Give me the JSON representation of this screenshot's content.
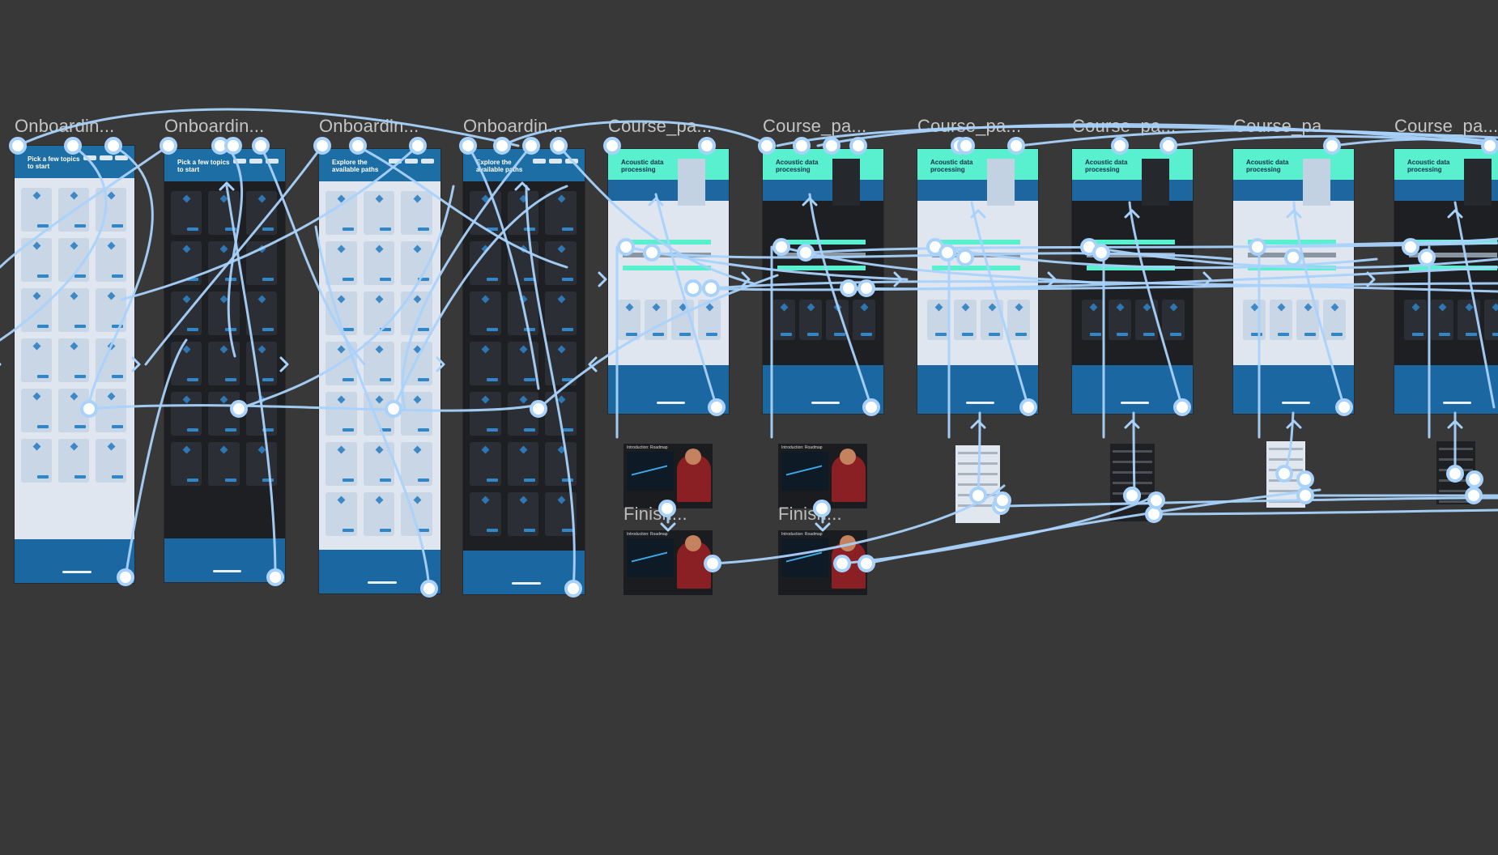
{
  "canvas": {
    "background": "#383838",
    "wire_color": "#a9d2fb",
    "node_fill": "#ffffff"
  },
  "frames": [
    {
      "label": "Onboardin...",
      "theme": "light",
      "kind": "onboarding",
      "title": "Pick a few topics to start"
    },
    {
      "label": "Onboardin...",
      "theme": "dark",
      "kind": "onboarding",
      "title": "Pick a few topics to start"
    },
    {
      "label": "Onboardin...",
      "theme": "light",
      "kind": "onboarding",
      "title": "Explore the available paths"
    },
    {
      "label": "Onboardin...",
      "theme": "dark",
      "kind": "onboarding",
      "title": "Explore the available paths"
    },
    {
      "label": "Course_pa...",
      "theme": "light",
      "kind": "course",
      "title": "Acoustic data processing"
    },
    {
      "label": "Course_pa...",
      "theme": "dark",
      "kind": "course",
      "title": "Acoustic data processing"
    },
    {
      "label": "Course_pa...",
      "theme": "light",
      "kind": "course",
      "title": "Acoustic data processing"
    },
    {
      "label": "Course_pa...",
      "theme": "dark",
      "kind": "course",
      "title": "Acoustic data processing"
    },
    {
      "label": "Course_pa...",
      "theme": "light",
      "kind": "course",
      "title": "Acoustic data processing"
    },
    {
      "label": "Course_pa...",
      "theme": "dark",
      "kind": "course",
      "title": "Acoustic data processing"
    }
  ],
  "video_thumbs": [
    {
      "caption": "Introduction: Roadmap"
    },
    {
      "caption": "Introduction: Roadmap"
    },
    {
      "caption": "Introduction: Roadmap"
    },
    {
      "caption": "Introduction: Roadmap"
    }
  ],
  "finish_labels": [
    "Finish...",
    "Finish..."
  ],
  "mini_frames": [
    {
      "theme": "light"
    },
    {
      "theme": "dark"
    },
    {
      "theme": "light"
    },
    {
      "theme": "dark"
    }
  ]
}
